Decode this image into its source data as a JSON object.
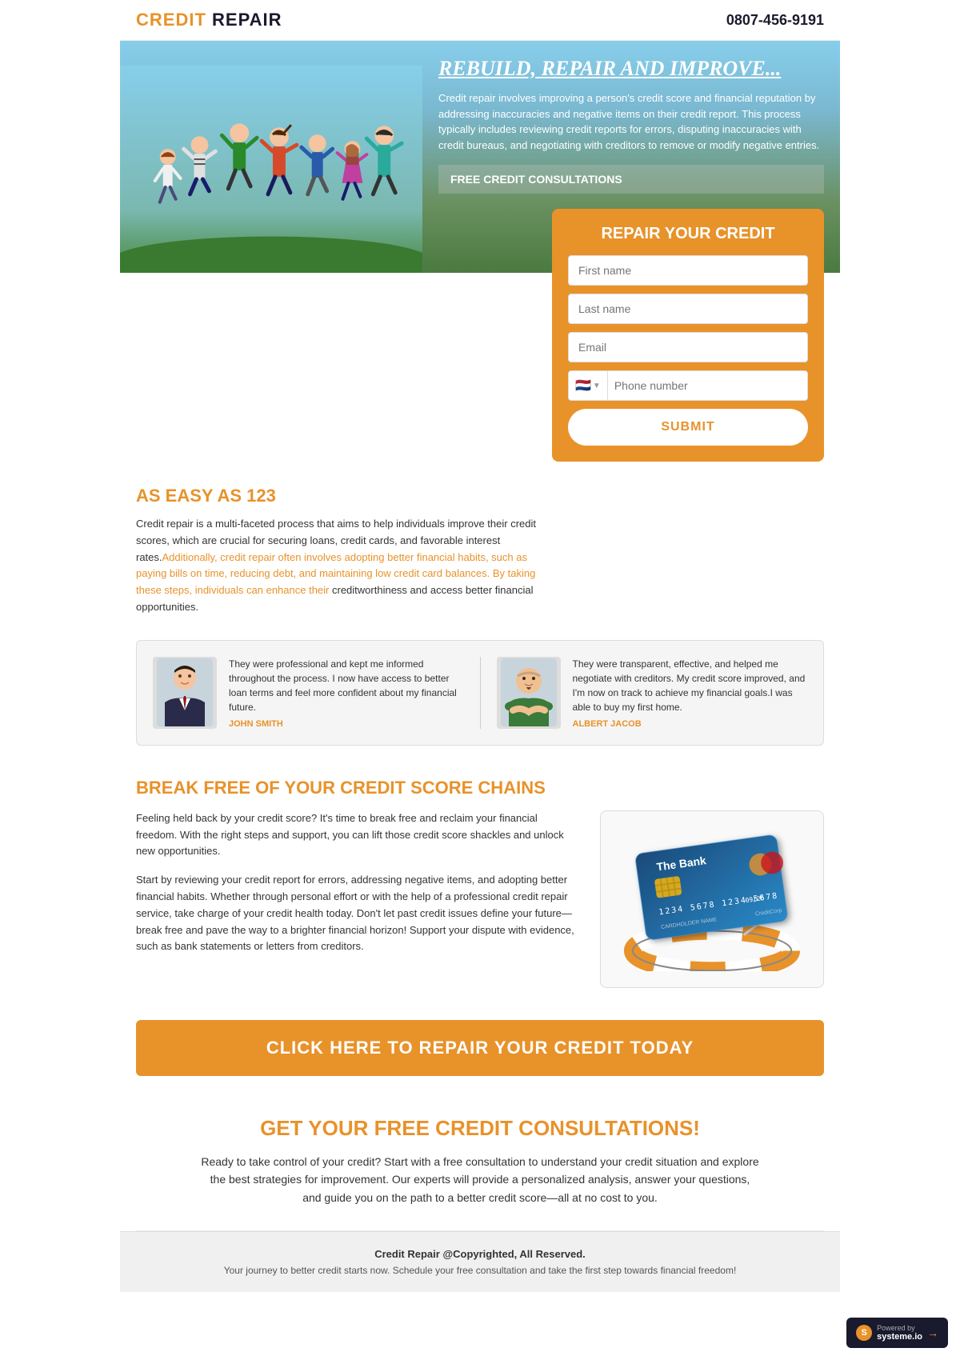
{
  "header": {
    "logo_credit": "CREDIT",
    "logo_repair": " REPAIR",
    "phone": "0807-456-9191"
  },
  "hero": {
    "title": "REBUILD, REPAIR AND IMPROVE...",
    "description": "Credit repair involves improving a person's credit score and financial reputation by addressing inaccuracies and negative items on their credit report. This process typically includes reviewing credit reports for errors, disputing inaccuracies with credit bureaus, and negotiating with creditors to remove or modify negative entries.",
    "free_consult_label": "FREE CREDIT CONSULTATIONS"
  },
  "form": {
    "title": "REPAIR YOUR CREDIT",
    "first_name_placeholder": "First name",
    "last_name_placeholder": "Last name",
    "email_placeholder": "Email",
    "phone_placeholder": "Phone number",
    "submit_label": "SUBMIT"
  },
  "easy_section": {
    "title_prefix": "AS EASY AS",
    "title_number": "123",
    "body_text": "Credit repair is a multi-faceted process that aims to help individuals improve their credit scores, which are crucial for securing loans, credit cards, and favorable interest rates.",
    "body_orange": "Additionally, credit repair often involves adopting better financial habits, such as paying bills on time, reducing debt, and maintaining low credit card balances. By taking these steps, individuals can enhance their",
    "body_suffix": " creditworthiness and access better financial opportunities."
  },
  "testimonials": [
    {
      "text": "They were professional and kept me informed throughout the process. I now have access to better loan terms and feel more confident about my financial future.",
      "name": "JOHN SMITH",
      "avatar_type": "suit"
    },
    {
      "text": "They were transparent, effective, and helped me negotiate with creditors. My credit score improved, and I'm now on track to achieve my financial goals.I was able to buy my first home.",
      "name": "ALBERT JACOB",
      "avatar_type": "casual"
    }
  ],
  "break_free": {
    "title_orange": "BREAK FREE",
    "title_rest": " OF YOUR CREDIT SCORE CHAINS",
    "para1": "Feeling held back by your credit score? It's time to break free and reclaim your financial freedom. With the right steps and support, you can lift those credit score shackles and unlock new opportunities.",
    "para2": "Start by reviewing your credit report for errors, addressing negative items, and adopting better financial habits. Whether through personal effort or with the help of a professional credit repair service, take charge of your credit health today. Don't let past credit issues define your future—break free and pave the way to a brighter financial horizon! Support your dispute with evidence, such as bank statements or letters from creditors.",
    "card_bank": "The Bank",
    "card_number": "1234 5678 1234 5678",
    "card_holder": "CARDHOLDER NAME    CreditCorp"
  },
  "cta": {
    "button_label": "CLICK HERE TO REPAIR YOUR CREDIT TODAY"
  },
  "free_consult_section": {
    "title_prefix": "GET YOUR ",
    "title_free": "FREE",
    "title_suffix": " CREDIT CONSULTATIONS!",
    "body": "Ready to take control of your credit? Start with a free consultation to understand your credit situation and explore the best strategies for improvement. Our experts will provide a personalized analysis, answer your questions, and guide you on the path to a better credit score—all at no cost to you."
  },
  "footer": {
    "copyright": "Credit Repair @Copyrighted, All Reserved.",
    "tagline": "Your journey to better credit starts now. Schedule your free consultation and take the first step towards financial freedom!"
  },
  "systeme": {
    "label": "Powered by",
    "brand": "systeme.io"
  }
}
